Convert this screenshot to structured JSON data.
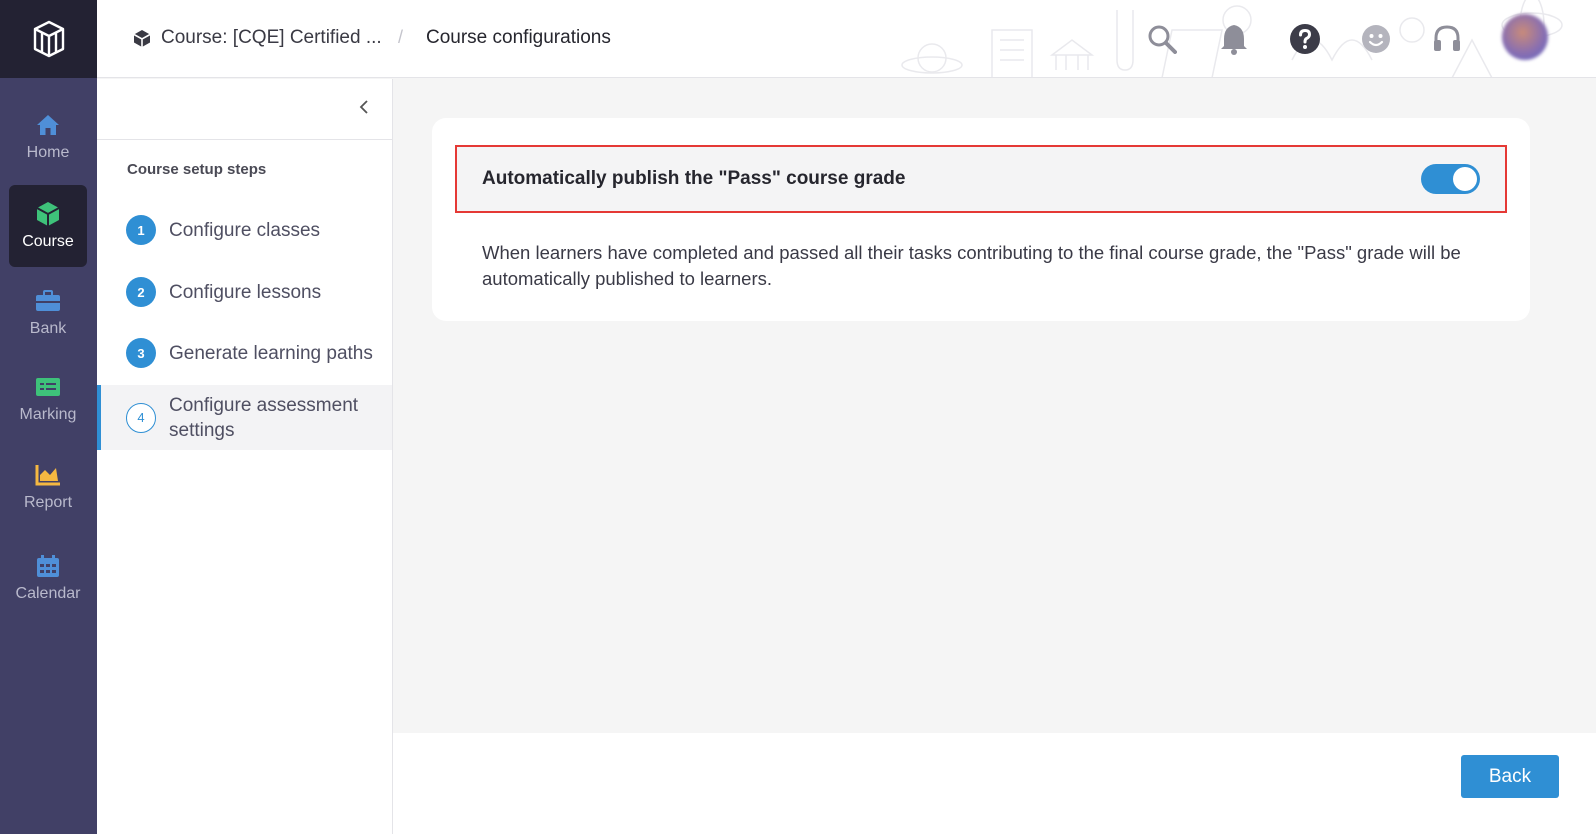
{
  "nav": {
    "items": [
      {
        "label": "Home",
        "icon": "home-icon",
        "color": "#4f8fd8"
      },
      {
        "label": "Course",
        "icon": "cube-icon",
        "color": "#3ec27a"
      },
      {
        "label": "Bank",
        "icon": "briefcase-icon",
        "color": "#4f8fd8"
      },
      {
        "label": "Marking",
        "icon": "list-icon",
        "color": "#3ec27a"
      },
      {
        "label": "Report",
        "icon": "chart-icon",
        "color": "#f5b841"
      },
      {
        "label": "Calendar",
        "icon": "calendar-icon",
        "color": "#4f8fd8"
      }
    ],
    "active": "Course"
  },
  "breadcrumb": {
    "course": "Course: [CQE] Certified ...",
    "separator": "/",
    "current": "Course configurations"
  },
  "steps": {
    "title": "Course setup steps",
    "items": [
      {
        "num": "1",
        "label": "Configure classes"
      },
      {
        "num": "2",
        "label": "Configure lessons"
      },
      {
        "num": "3",
        "label": "Generate learning paths"
      },
      {
        "num": "4",
        "label": "Configure assessment settings"
      }
    ]
  },
  "setting": {
    "label": "Automatically publish the \"Pass\" course grade",
    "enabled": true,
    "description": "When learners have completed and passed all their tasks contributing to the final course grade, the \"Pass\" grade will be automatically published to learners."
  },
  "footer": {
    "back_label": "Back"
  },
  "colors": {
    "accent": "#2f8fd4",
    "sidebar": "#414066",
    "sidebar_dark": "#232233",
    "highlight_border": "#e53935"
  }
}
